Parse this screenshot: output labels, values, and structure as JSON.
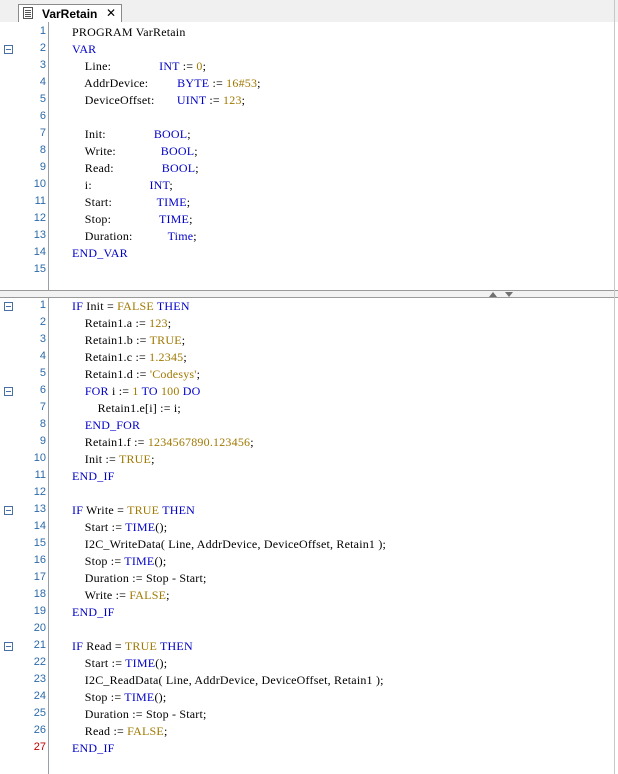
{
  "tab": {
    "title": "VarRetain",
    "close": "✕",
    "icon": "document-icon"
  },
  "declaration": [
    {
      "n": "1",
      "fold": false,
      "segs": [
        [
          "PROGRAM VarRetain",
          "plain"
        ]
      ]
    },
    {
      "n": "2",
      "fold": true,
      "segs": [
        [
          "VAR",
          "kw"
        ]
      ]
    },
    {
      "n": "3",
      "fold": false,
      "segs": [
        [
          "    Line:               ",
          "plain"
        ],
        [
          "INT",
          "kw"
        ],
        [
          " := ",
          "plain"
        ],
        [
          "0",
          "num"
        ],
        [
          ";",
          "plain"
        ]
      ]
    },
    {
      "n": "4",
      "fold": false,
      "segs": [
        [
          "    AddrDevice:         ",
          "plain"
        ],
        [
          "BYTE",
          "kw"
        ],
        [
          " := ",
          "plain"
        ],
        [
          "16#53",
          "num"
        ],
        [
          ";",
          "plain"
        ]
      ]
    },
    {
      "n": "5",
      "fold": false,
      "segs": [
        [
          "    DeviceOffset:       ",
          "plain"
        ],
        [
          "UINT",
          "kw"
        ],
        [
          " := ",
          "plain"
        ],
        [
          "123",
          "num"
        ],
        [
          ";",
          "plain"
        ]
      ]
    },
    {
      "n": "6",
      "fold": false,
      "segs": [
        [
          "",
          "plain"
        ]
      ]
    },
    {
      "n": "7",
      "fold": false,
      "segs": [
        [
          "    Init:               ",
          "plain"
        ],
        [
          "BOOL",
          "kw"
        ],
        [
          ";",
          "plain"
        ]
      ]
    },
    {
      "n": "8",
      "fold": false,
      "segs": [
        [
          "    Write:              ",
          "plain"
        ],
        [
          "BOOL",
          "kw"
        ],
        [
          ";",
          "plain"
        ]
      ]
    },
    {
      "n": "9",
      "fold": false,
      "segs": [
        [
          "    Read:               ",
          "plain"
        ],
        [
          "BOOL",
          "kw"
        ],
        [
          ";",
          "plain"
        ]
      ]
    },
    {
      "n": "10",
      "fold": false,
      "segs": [
        [
          "    i:                  ",
          "plain"
        ],
        [
          "INT",
          "kw"
        ],
        [
          ";",
          "plain"
        ]
      ]
    },
    {
      "n": "11",
      "fold": false,
      "segs": [
        [
          "    Start:              ",
          "plain"
        ],
        [
          "TIME",
          "kw"
        ],
        [
          ";",
          "plain"
        ]
      ]
    },
    {
      "n": "12",
      "fold": false,
      "segs": [
        [
          "    Stop:               ",
          "plain"
        ],
        [
          "TIME",
          "kw"
        ],
        [
          ";",
          "plain"
        ]
      ]
    },
    {
      "n": "13",
      "fold": false,
      "segs": [
        [
          "    Duration:           ",
          "plain"
        ],
        [
          "Time",
          "kw"
        ],
        [
          ";",
          "plain"
        ]
      ]
    },
    {
      "n": "14",
      "fold": false,
      "segs": [
        [
          "END_VAR",
          "kw"
        ]
      ]
    },
    {
      "n": "15",
      "fold": false,
      "segs": [
        [
          "",
          "plain"
        ]
      ]
    }
  ],
  "implementation": [
    {
      "n": "1",
      "fold": true,
      "segs": [
        [
          "IF",
          "kw"
        ],
        [
          " Init = ",
          "plain"
        ],
        [
          "FALSE",
          "num"
        ],
        [
          " ",
          "plain"
        ],
        [
          "THEN",
          "kw"
        ]
      ]
    },
    {
      "n": "2",
      "fold": false,
      "segs": [
        [
          "    Retain1.a := ",
          "plain"
        ],
        [
          "123",
          "num"
        ],
        [
          ";",
          "plain"
        ]
      ]
    },
    {
      "n": "3",
      "fold": false,
      "segs": [
        [
          "    Retain1.b := ",
          "plain"
        ],
        [
          "TRUE",
          "num"
        ],
        [
          ";",
          "plain"
        ]
      ]
    },
    {
      "n": "4",
      "fold": false,
      "segs": [
        [
          "    Retain1.c := ",
          "plain"
        ],
        [
          "1.2345",
          "num"
        ],
        [
          ";",
          "plain"
        ]
      ]
    },
    {
      "n": "5",
      "fold": false,
      "segs": [
        [
          "    Retain1.d := ",
          "plain"
        ],
        [
          "'Codesys'",
          "str"
        ],
        [
          ";",
          "plain"
        ]
      ]
    },
    {
      "n": "6",
      "fold": true,
      "segs": [
        [
          "    ",
          "plain"
        ],
        [
          "FOR",
          "kw"
        ],
        [
          " i := ",
          "plain"
        ],
        [
          "1",
          "num"
        ],
        [
          " ",
          "plain"
        ],
        [
          "TO",
          "kw"
        ],
        [
          " ",
          "plain"
        ],
        [
          "100",
          "num"
        ],
        [
          " ",
          "plain"
        ],
        [
          "DO",
          "kw"
        ]
      ]
    },
    {
      "n": "7",
      "fold": false,
      "segs": [
        [
          "        Retain1.e[i] := i;",
          "plain"
        ]
      ]
    },
    {
      "n": "8",
      "fold": false,
      "segs": [
        [
          "    ",
          "plain"
        ],
        [
          "END_FOR",
          "kw"
        ]
      ]
    },
    {
      "n": "9",
      "fold": false,
      "segs": [
        [
          "    Retain1.f := ",
          "plain"
        ],
        [
          "1234567890.123456",
          "num"
        ],
        [
          ";",
          "plain"
        ]
      ]
    },
    {
      "n": "10",
      "fold": false,
      "segs": [
        [
          "    Init := ",
          "plain"
        ],
        [
          "TRUE",
          "num"
        ],
        [
          ";",
          "plain"
        ]
      ]
    },
    {
      "n": "11",
      "fold": false,
      "segs": [
        [
          "END_IF",
          "kw"
        ]
      ]
    },
    {
      "n": "12",
      "fold": false,
      "segs": [
        [
          "",
          "plain"
        ]
      ]
    },
    {
      "n": "13",
      "fold": true,
      "segs": [
        [
          "IF",
          "kw"
        ],
        [
          " Write = ",
          "plain"
        ],
        [
          "TRUE",
          "num"
        ],
        [
          " ",
          "plain"
        ],
        [
          "THEN",
          "kw"
        ]
      ]
    },
    {
      "n": "14",
      "fold": false,
      "segs": [
        [
          "    Start := ",
          "plain"
        ],
        [
          "TIME",
          "kw"
        ],
        [
          "();",
          "plain"
        ]
      ]
    },
    {
      "n": "15",
      "fold": false,
      "segs": [
        [
          "    I2C_WriteData( Line, AddrDevice, DeviceOffset, Retain1 );",
          "plain"
        ]
      ]
    },
    {
      "n": "16",
      "fold": false,
      "segs": [
        [
          "    Stop := ",
          "plain"
        ],
        [
          "TIME",
          "kw"
        ],
        [
          "();",
          "plain"
        ]
      ]
    },
    {
      "n": "17",
      "fold": false,
      "segs": [
        [
          "    Duration := Stop - Start;",
          "plain"
        ]
      ]
    },
    {
      "n": "18",
      "fold": false,
      "segs": [
        [
          "    Write := ",
          "plain"
        ],
        [
          "FALSE",
          "num"
        ],
        [
          ";",
          "plain"
        ]
      ]
    },
    {
      "n": "19",
      "fold": false,
      "segs": [
        [
          "END_IF",
          "kw"
        ]
      ]
    },
    {
      "n": "20",
      "fold": false,
      "segs": [
        [
          "",
          "plain"
        ]
      ]
    },
    {
      "n": "21",
      "fold": true,
      "segs": [
        [
          "IF",
          "kw"
        ],
        [
          " Read = ",
          "plain"
        ],
        [
          "TRUE",
          "num"
        ],
        [
          " ",
          "plain"
        ],
        [
          "THEN",
          "kw"
        ]
      ]
    },
    {
      "n": "22",
      "fold": false,
      "segs": [
        [
          "    Start := ",
          "plain"
        ],
        [
          "TIME",
          "kw"
        ],
        [
          "();",
          "plain"
        ]
      ]
    },
    {
      "n": "23",
      "fold": false,
      "segs": [
        [
          "    I2C_ReadData( Line, AddrDevice, DeviceOffset, Retain1 );",
          "plain"
        ]
      ]
    },
    {
      "n": "24",
      "fold": false,
      "segs": [
        [
          "    Stop := ",
          "plain"
        ],
        [
          "TIME",
          "kw"
        ],
        [
          "();",
          "plain"
        ]
      ]
    },
    {
      "n": "25",
      "fold": false,
      "segs": [
        [
          "    Duration := Stop - Start;",
          "plain"
        ]
      ]
    },
    {
      "n": "26",
      "fold": false,
      "segs": [
        [
          "    Read := ",
          "plain"
        ],
        [
          "FALSE",
          "num"
        ],
        [
          ";",
          "plain"
        ]
      ]
    },
    {
      "n": "27",
      "fold": false,
      "segs": [
        [
          "END_IF",
          "kw"
        ]
      ]
    }
  ],
  "colors": {
    "keyword": "#0000c8",
    "literal": "#a07800",
    "line_number": "#2b6aa8",
    "current_line_number": "#c00000"
  },
  "current_line": "27"
}
